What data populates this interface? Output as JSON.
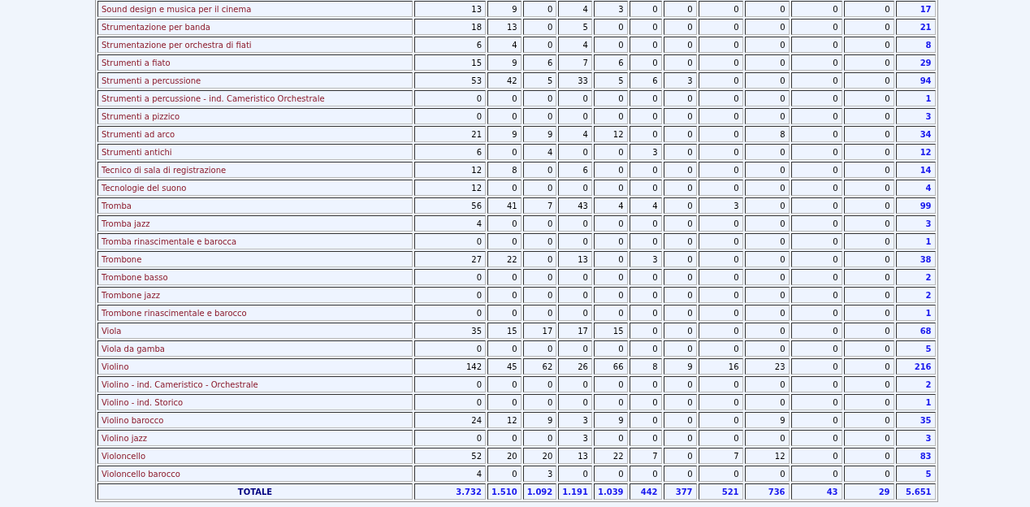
{
  "table": {
    "rows": [
      {
        "name": "Sound design e musica per il cinema",
        "values": [
          "13",
          "9",
          "0",
          "4",
          "3",
          "0",
          "0",
          "0",
          "0",
          "0",
          "0"
        ],
        "total": "17"
      },
      {
        "name": "Strumentazione per banda",
        "values": [
          "18",
          "13",
          "0",
          "5",
          "0",
          "0",
          "0",
          "0",
          "0",
          "0",
          "0"
        ],
        "total": "21"
      },
      {
        "name": "Strumentazione per orchestra di fiati",
        "values": [
          "6",
          "4",
          "0",
          "4",
          "0",
          "0",
          "0",
          "0",
          "0",
          "0",
          "0"
        ],
        "total": "8"
      },
      {
        "name": "Strumenti a fiato",
        "values": [
          "15",
          "9",
          "6",
          "7",
          "6",
          "0",
          "0",
          "0",
          "0",
          "0",
          "0"
        ],
        "total": "29"
      },
      {
        "name": "Strumenti a percussione",
        "values": [
          "53",
          "42",
          "5",
          "33",
          "5",
          "6",
          "3",
          "0",
          "0",
          "0",
          "0"
        ],
        "total": "94"
      },
      {
        "name": "Strumenti a percussione - ind. Cameristico Orchestrale",
        "values": [
          "0",
          "0",
          "0",
          "0",
          "0",
          "0",
          "0",
          "0",
          "0",
          "0",
          "0"
        ],
        "total": "1"
      },
      {
        "name": "Strumenti a pizzico",
        "values": [
          "0",
          "0",
          "0",
          "0",
          "0",
          "0",
          "0",
          "0",
          "0",
          "0",
          "0"
        ],
        "total": "3"
      },
      {
        "name": "Strumenti ad arco",
        "values": [
          "21",
          "9",
          "9",
          "4",
          "12",
          "0",
          "0",
          "0",
          "8",
          "0",
          "0"
        ],
        "total": "34"
      },
      {
        "name": "Strumenti antichi",
        "values": [
          "6",
          "0",
          "4",
          "0",
          "0",
          "3",
          "0",
          "0",
          "0",
          "0",
          "0"
        ],
        "total": "12"
      },
      {
        "name": "Tecnico di sala di registrazione",
        "values": [
          "12",
          "8",
          "0",
          "6",
          "0",
          "0",
          "0",
          "0",
          "0",
          "0",
          "0"
        ],
        "total": "14"
      },
      {
        "name": "Tecnologie del suono",
        "values": [
          "12",
          "0",
          "0",
          "0",
          "0",
          "0",
          "0",
          "0",
          "0",
          "0",
          "0"
        ],
        "total": "4"
      },
      {
        "name": "Tromba",
        "values": [
          "56",
          "41",
          "7",
          "43",
          "4",
          "4",
          "0",
          "3",
          "0",
          "0",
          "0"
        ],
        "total": "99"
      },
      {
        "name": "Tromba jazz",
        "values": [
          "4",
          "0",
          "0",
          "0",
          "0",
          "0",
          "0",
          "0",
          "0",
          "0",
          "0"
        ],
        "total": "3"
      },
      {
        "name": "Tromba rinascimentale e barocca",
        "values": [
          "0",
          "0",
          "0",
          "0",
          "0",
          "0",
          "0",
          "0",
          "0",
          "0",
          "0"
        ],
        "total": "1"
      },
      {
        "name": "Trombone",
        "values": [
          "27",
          "22",
          "0",
          "13",
          "0",
          "3",
          "0",
          "0",
          "0",
          "0",
          "0"
        ],
        "total": "38"
      },
      {
        "name": "Trombone basso",
        "values": [
          "0",
          "0",
          "0",
          "0",
          "0",
          "0",
          "0",
          "0",
          "0",
          "0",
          "0"
        ],
        "total": "2"
      },
      {
        "name": "Trombone jazz",
        "values": [
          "0",
          "0",
          "0",
          "0",
          "0",
          "0",
          "0",
          "0",
          "0",
          "0",
          "0"
        ],
        "total": "2"
      },
      {
        "name": "Trombone rinascimentale e barocco",
        "values": [
          "0",
          "0",
          "0",
          "0",
          "0",
          "0",
          "0",
          "0",
          "0",
          "0",
          "0"
        ],
        "total": "1"
      },
      {
        "name": "Viola",
        "values": [
          "35",
          "15",
          "17",
          "17",
          "15",
          "0",
          "0",
          "0",
          "0",
          "0",
          "0"
        ],
        "total": "68"
      },
      {
        "name": "Viola da gamba",
        "values": [
          "0",
          "0",
          "0",
          "0",
          "0",
          "0",
          "0",
          "0",
          "0",
          "0",
          "0"
        ],
        "total": "5"
      },
      {
        "name": "Violino",
        "values": [
          "142",
          "45",
          "62",
          "26",
          "66",
          "8",
          "9",
          "16",
          "23",
          "0",
          "0"
        ],
        "total": "216"
      },
      {
        "name": "Violino - ind. Cameristico - Orchestrale",
        "values": [
          "0",
          "0",
          "0",
          "0",
          "0",
          "0",
          "0",
          "0",
          "0",
          "0",
          "0"
        ],
        "total": "2"
      },
      {
        "name": "Violino - ind. Storico",
        "values": [
          "0",
          "0",
          "0",
          "0",
          "0",
          "0",
          "0",
          "0",
          "0",
          "0",
          "0"
        ],
        "total": "1"
      },
      {
        "name": "Violino barocco",
        "values": [
          "24",
          "12",
          "9",
          "3",
          "9",
          "0",
          "0",
          "0",
          "9",
          "0",
          "0"
        ],
        "total": "35"
      },
      {
        "name": "Violino jazz",
        "values": [
          "0",
          "0",
          "0",
          "3",
          "0",
          "0",
          "0",
          "0",
          "0",
          "0",
          "0"
        ],
        "total": "3"
      },
      {
        "name": "Violoncello",
        "values": [
          "52",
          "20",
          "20",
          "13",
          "22",
          "7",
          "0",
          "7",
          "12",
          "0",
          "0"
        ],
        "total": "83"
      },
      {
        "name": "Violoncello barocco",
        "values": [
          "4",
          "0",
          "3",
          "0",
          "0",
          "0",
          "0",
          "0",
          "0",
          "0",
          "0"
        ],
        "total": "5"
      }
    ],
    "total_row": {
      "label": "TOTALE",
      "values": [
        "3.732",
        "1.510",
        "1.092",
        "1.191",
        "1.039",
        "442",
        "377",
        "521",
        "736",
        "43",
        "29"
      ],
      "total": "5.651"
    }
  }
}
